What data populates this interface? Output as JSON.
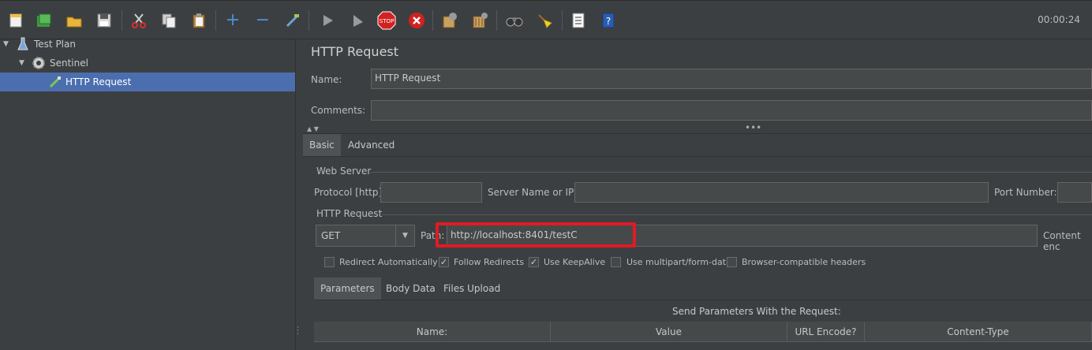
{
  "toolbar": {
    "icons": [
      "new-icon",
      "templates-icon",
      "open-icon",
      "save-icon",
      "cut-icon",
      "copy-icon",
      "paste-icon",
      "expand-icon",
      "collapse-icon",
      "toggle-icon",
      "start-icon",
      "start-no-pauses-icon",
      "stop-icon",
      "shutdown-icon",
      "clear-icon",
      "clear-all-icon",
      "search-icon",
      "reset-search-icon",
      "function-helper-icon",
      "help-icon"
    ],
    "timer": "00:00:24"
  },
  "tree": {
    "items": [
      {
        "label": "Test Plan",
        "icon": "test-plan-icon"
      },
      {
        "label": "Sentinel",
        "icon": "thread-group-gear-icon"
      },
      {
        "label": "HTTP Request",
        "icon": "sampler-pipette-icon"
      }
    ]
  },
  "panel": {
    "title": "HTTP Request",
    "name_label": "Name:",
    "name_value": "HTTP Request",
    "comments_label": "Comments:",
    "comments_value": "",
    "tabs": [
      "Basic",
      "Advanced"
    ],
    "web_server": {
      "legend": "Web Server",
      "protocol_label": "Protocol [http]:",
      "protocol_value": "",
      "server_label": "Server Name or IP:",
      "server_value": "",
      "port_label": "Port Number:",
      "port_value": ""
    },
    "http_request": {
      "legend": "HTTP Request",
      "method": "GET",
      "path_label": "Path:",
      "path_value": "http://localhost:8401/testC",
      "content_encoding_label": "Content enc"
    },
    "options": [
      {
        "label": "Redirect Automatically",
        "checked": false
      },
      {
        "label": "Follow Redirects",
        "checked": true
      },
      {
        "label": "Use KeepAlive",
        "checked": true
      },
      {
        "label": "Use multipart/form-data",
        "checked": false
      },
      {
        "label": "Browser-compatible headers",
        "checked": false
      }
    ],
    "subtabs": [
      "Parameters",
      "Body Data",
      "Files Upload"
    ],
    "table_caption": "Send Parameters With the Request:",
    "columns": [
      "Name:",
      "Value",
      "URL Encode?",
      "Content-Type"
    ]
  }
}
